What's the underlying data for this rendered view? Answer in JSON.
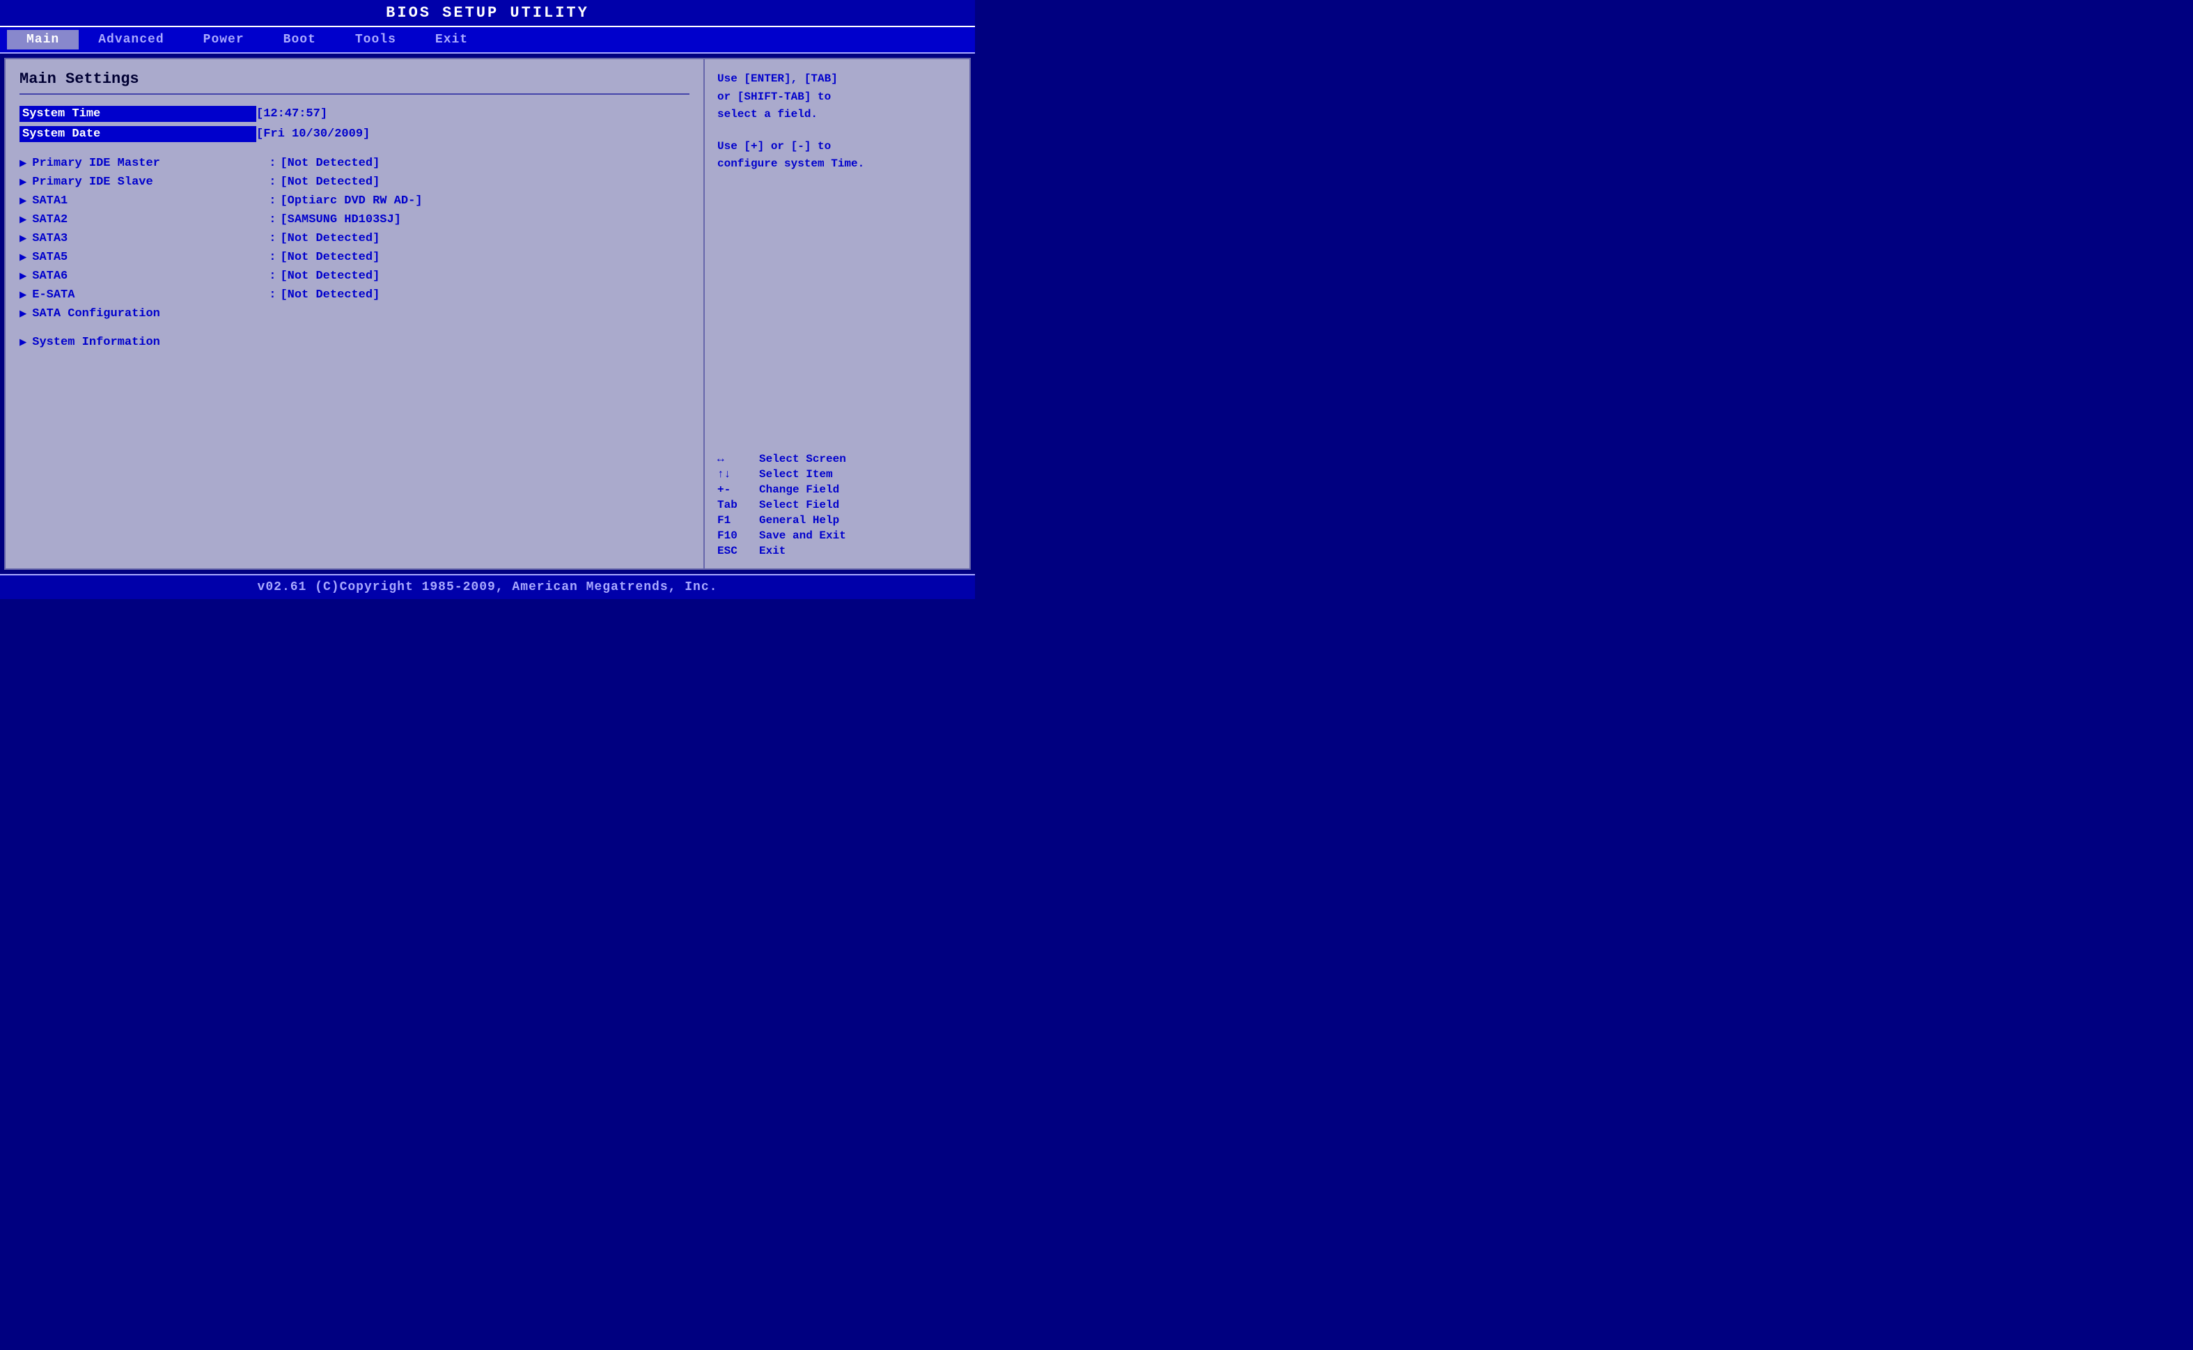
{
  "title": "BIOS SETUP UTILITY",
  "menu": {
    "items": [
      {
        "label": "Main",
        "active": true
      },
      {
        "label": "Advanced",
        "active": false
      },
      {
        "label": "Power",
        "active": false
      },
      {
        "label": "Boot",
        "active": false
      },
      {
        "label": "Tools",
        "active": false
      },
      {
        "label": "Exit",
        "active": false
      }
    ]
  },
  "left": {
    "section_title": "Main Settings",
    "rows": [
      {
        "type": "setting",
        "label": "System Time",
        "value": "[12:47:57]",
        "separator": "",
        "arrow": false,
        "highlighted": true
      },
      {
        "type": "setting",
        "label": "System Date",
        "value": "[Fri 10/30/2009]",
        "separator": "",
        "arrow": false,
        "highlighted": true
      },
      {
        "type": "spacer"
      },
      {
        "type": "setting",
        "label": "Primary IDE Master",
        "value": "[Not Detected]",
        "separator": ":",
        "arrow": true,
        "highlighted": false
      },
      {
        "type": "setting",
        "label": "Primary IDE Slave",
        "value": "[Not Detected]",
        "separator": ":",
        "arrow": true,
        "highlighted": false
      },
      {
        "type": "setting",
        "label": "SATA1",
        "value": "[Optiarc DVD RW AD-]",
        "separator": ":",
        "arrow": true,
        "highlighted": false
      },
      {
        "type": "setting",
        "label": "SATA2",
        "value": "[SAMSUNG HD103SJ]",
        "separator": ":",
        "arrow": true,
        "highlighted": false
      },
      {
        "type": "setting",
        "label": "SATA3",
        "value": "[Not Detected]",
        "separator": ":",
        "arrow": true,
        "highlighted": false
      },
      {
        "type": "setting",
        "label": "SATA5",
        "value": "[Not Detected]",
        "separator": ":",
        "arrow": true,
        "highlighted": false
      },
      {
        "type": "setting",
        "label": "SATA6",
        "value": "[Not Detected]",
        "separator": ":",
        "arrow": true,
        "highlighted": false
      },
      {
        "type": "setting",
        "label": "E-SATA",
        "value": "[Not Detected]",
        "separator": ":",
        "arrow": true,
        "highlighted": false
      },
      {
        "type": "setting",
        "label": "SATA Configuration",
        "value": "",
        "separator": "",
        "arrow": true,
        "highlighted": false
      },
      {
        "type": "spacer"
      },
      {
        "type": "setting",
        "label": "System Information",
        "value": "",
        "separator": "",
        "arrow": true,
        "highlighted": false
      }
    ]
  },
  "right": {
    "help1": "Use [ENTER], [TAB]\nor [SHIFT-TAB] to\nselect a field.",
    "help2": "Use [+] or [-] to\nconfigure system Time.",
    "keys": [
      {
        "key": "↔",
        "desc": "Select Screen"
      },
      {
        "key": "↑↓",
        "desc": "Select Item"
      },
      {
        "key": "+-",
        "desc": "Change Field"
      },
      {
        "key": "Tab",
        "desc": "Select Field"
      },
      {
        "key": "F1",
        "desc": "General Help"
      },
      {
        "key": "F10",
        "desc": "Save and Exit"
      },
      {
        "key": "ESC",
        "desc": "Exit"
      }
    ]
  },
  "footer": "v02.61  (C)Copyright 1985-2009, American Megatrends, Inc."
}
